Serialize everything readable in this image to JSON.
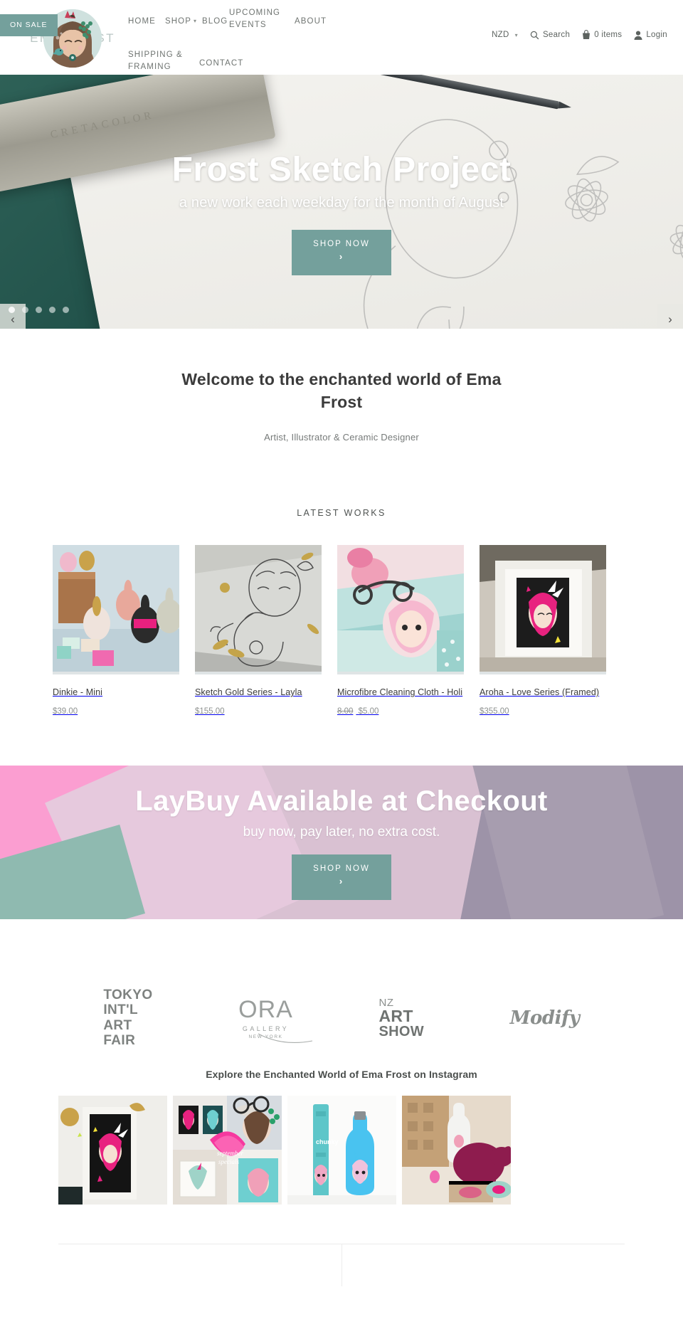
{
  "site": {
    "logo_text": "EMA FROST"
  },
  "nav": {
    "items": [
      {
        "label": "HOME",
        "has_caret": false
      },
      {
        "label": "SHOP",
        "has_caret": true
      },
      {
        "label": "BLOG",
        "has_caret": false
      },
      {
        "label": "UPCOMING EVENTS",
        "has_caret": false
      },
      {
        "label": "ABOUT",
        "has_caret": false
      },
      {
        "label": "SHIPPING & FRAMING",
        "has_caret": false
      },
      {
        "label": "CONTACT",
        "has_caret": false
      }
    ]
  },
  "header_right": {
    "currency": "NZD",
    "search_label": "Search",
    "cart_label": "0 items",
    "account_label": "Login"
  },
  "hero": {
    "title": "Frost Sketch Project",
    "subtitle": "a new work each weekday for the month of August",
    "cta_label": "SHOP NOW",
    "cta_chevron": "›",
    "prev_arrow": "‹",
    "next_arrow": "›",
    "slide_count": 5,
    "active_slide": 1,
    "tin_label": "CRETACOLOR"
  },
  "welcome": {
    "title": "Welcome to the enchanted world of Ema Frost",
    "subtitle": "Artist, Illustrator & Ceramic Designer"
  },
  "latest_works": {
    "heading": "LATEST WORKS",
    "products": [
      {
        "title": "Dinkie - Mini",
        "price": "$39.00",
        "old_price": null,
        "badge": null
      },
      {
        "title": "Sketch Gold Series - Layla",
        "price": "$155.00",
        "old_price": null,
        "badge": null
      },
      {
        "title": "Microfibre Cleaning Cloth - Holi",
        "price": "$5.00",
        "old_price": "8.00",
        "badge": "ON SALE"
      },
      {
        "title": "Aroha - Love Series (Framed)",
        "price": "$355.00",
        "old_price": null,
        "badge": null
      }
    ]
  },
  "laybuy": {
    "title": "LayBuy Available at Checkout",
    "subtitle": "buy now, pay later, no extra cost.",
    "cta_label": "SHOP NOW",
    "cta_chevron": "›"
  },
  "brands": [
    {
      "name": "TOKYO INT'L ART FAIR",
      "lines": [
        "TOKYO",
        "INT'L",
        "ART",
        "FAIR"
      ]
    },
    {
      "name": "ORA GALLERY NEW YORK",
      "word": "ORA",
      "line2": "GALLERY",
      "line3": "NEW YORK"
    },
    {
      "name": "NZ ART SHOW",
      "line1": "NZ",
      "line2": "ART",
      "line3": "SHOW"
    },
    {
      "name": "Modify",
      "word": "Modify"
    }
  ],
  "instagram": {
    "heading": "Explore the Enchanted World of Ema Frost on Instagram",
    "post_count": 4
  },
  "colors": {
    "teal": "#74a09c",
    "pink": "#fb9ed1",
    "mauve": "#d9c1d2",
    "grey_purple": "#9d93a8",
    "text_dark": "#3b3b3b",
    "text_muted": "#8d918f"
  }
}
